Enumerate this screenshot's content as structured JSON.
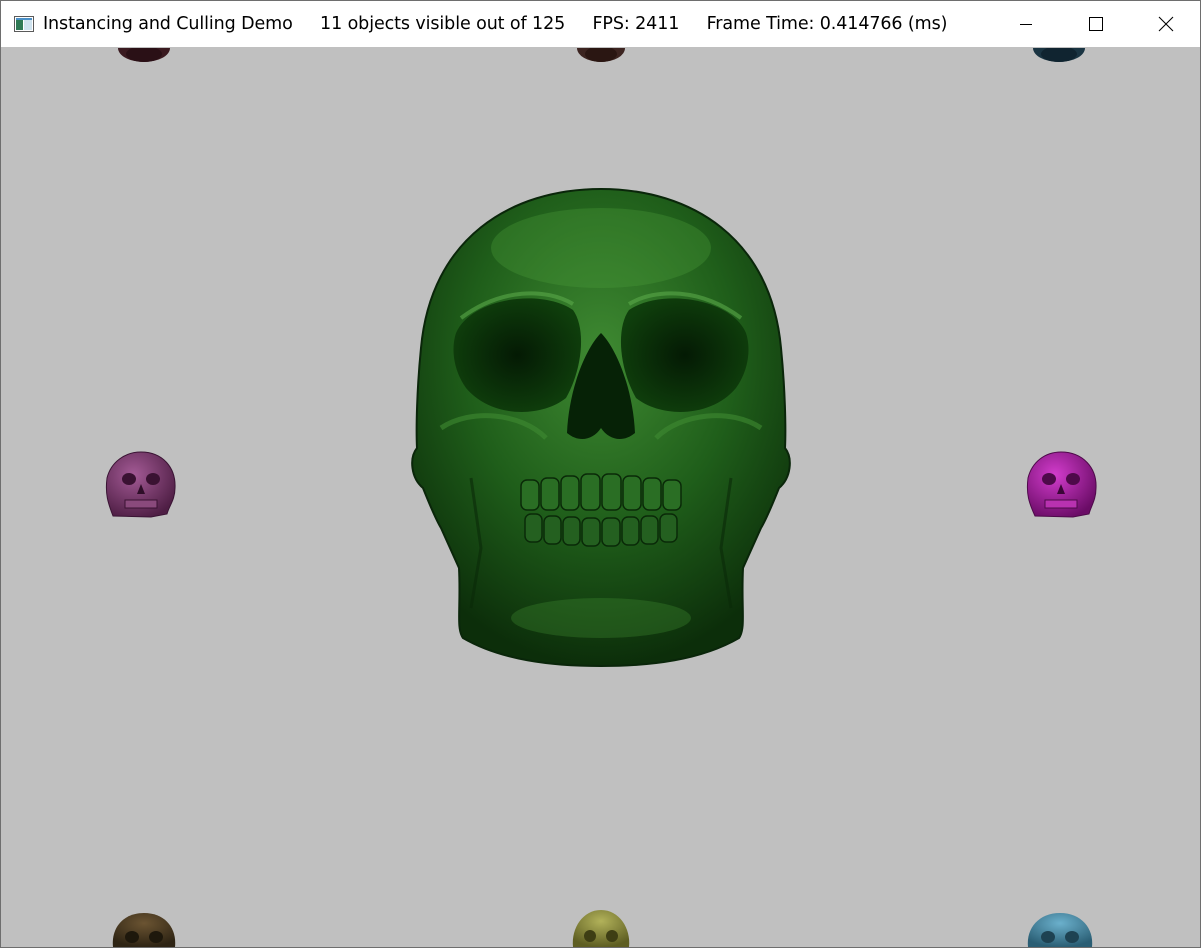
{
  "window": {
    "title": "Instancing and Culling Demo     11 objects visible out of 125     FPS: 2411     Frame Time: 0.414766 (ms)",
    "icon": "app-window-icon",
    "controls": [
      "minimize-icon",
      "maximize-icon",
      "close-icon"
    ]
  },
  "scene": {
    "background_color": "#c0c0c0",
    "objects": [
      {
        "name": "skull-center",
        "color": "#1f5a1a"
      },
      {
        "name": "skull-left-mid",
        "color": "#7a3f6e"
      },
      {
        "name": "skull-right-mid",
        "color": "#a01d9c"
      },
      {
        "name": "skull-top-left",
        "color": "#4a1f28"
      },
      {
        "name": "skull-top-center",
        "color": "#4a2a26"
      },
      {
        "name": "skull-top-right",
        "color": "#1f3a4a"
      },
      {
        "name": "skull-bottom-left",
        "color": "#4a3a22"
      },
      {
        "name": "skull-bottom-center",
        "color": "#8a8a3a"
      },
      {
        "name": "skull-bottom-right",
        "color": "#3f7a94"
      }
    ]
  }
}
